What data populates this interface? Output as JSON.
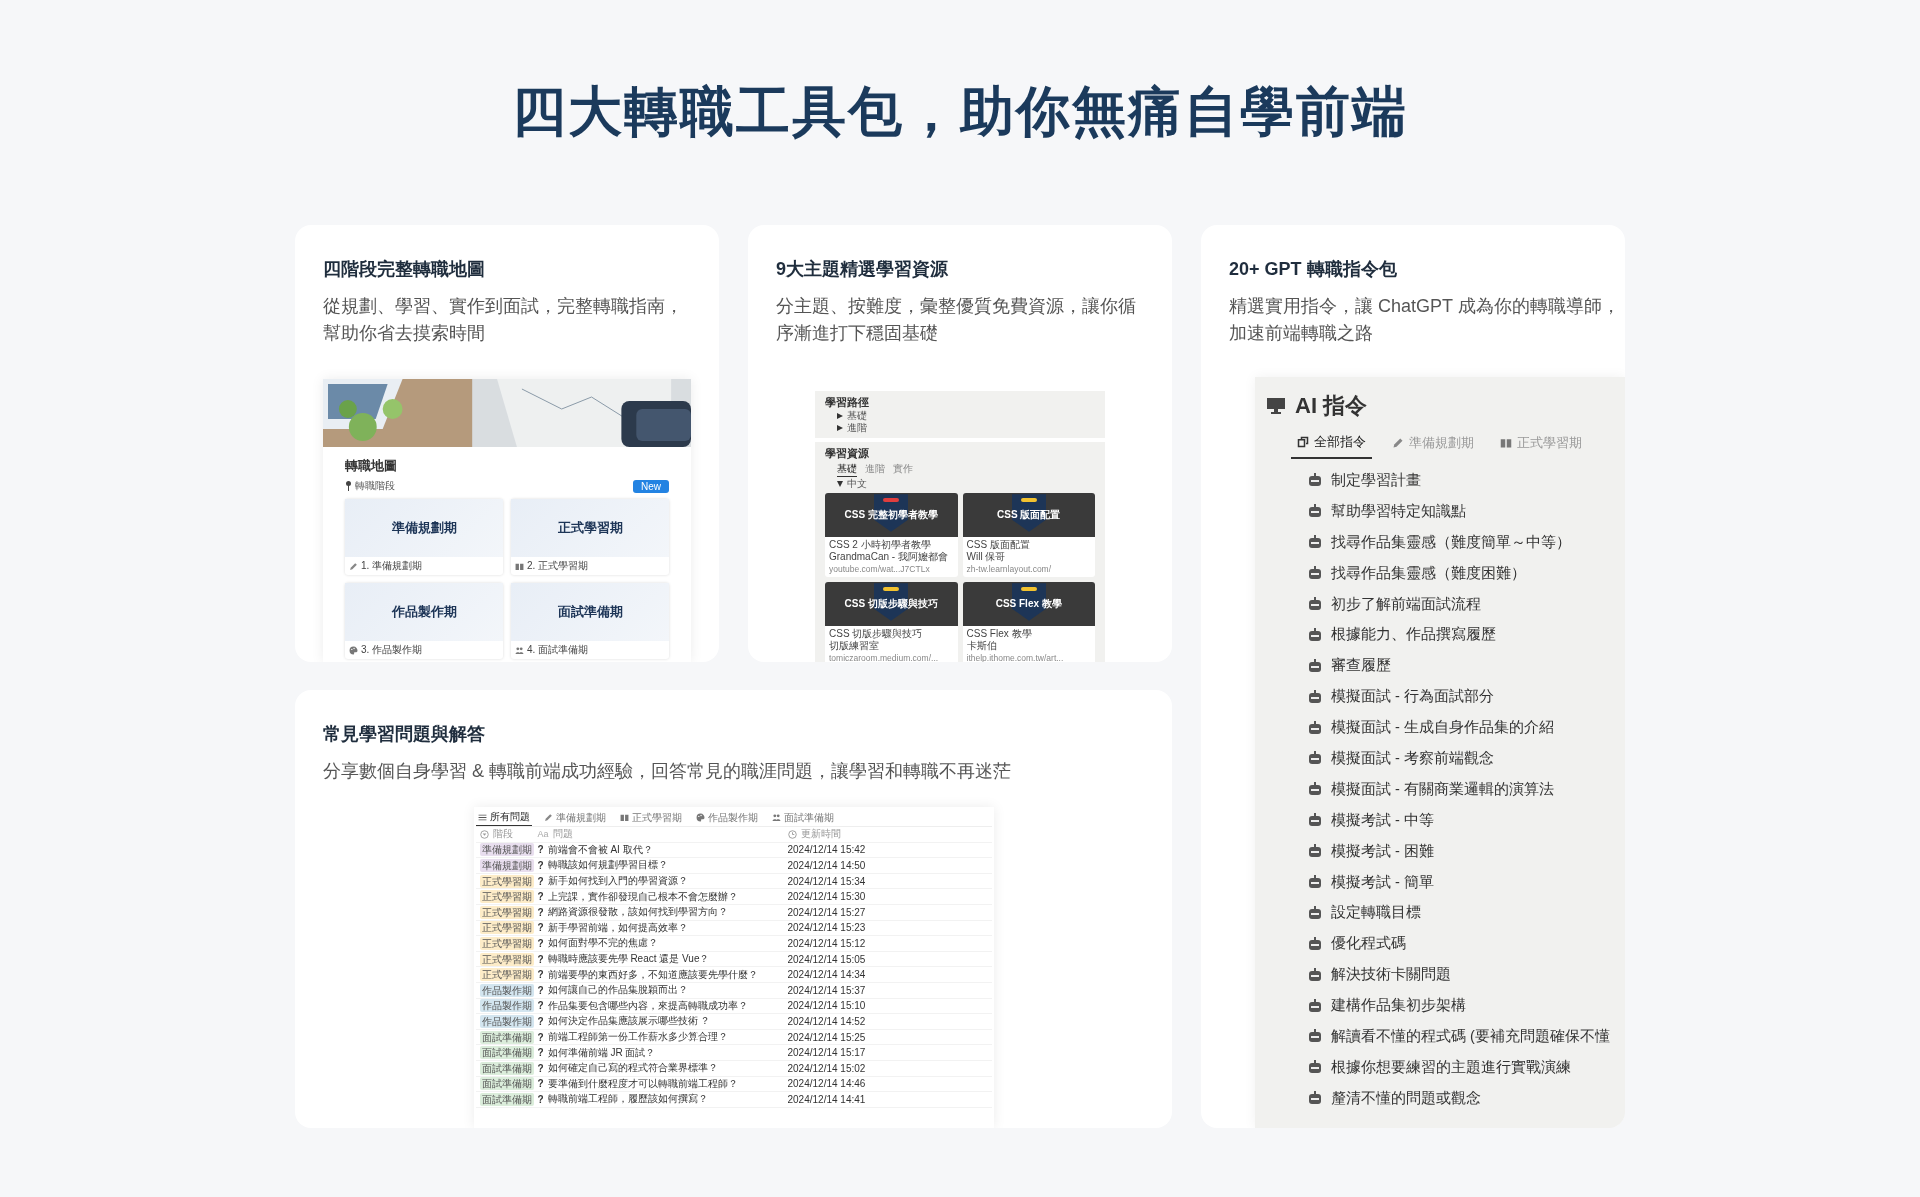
{
  "heading": "四大轉職工具包，助你無痛自學前端",
  "roadmap_card": {
    "title": "四階段完整轉職地圖",
    "description": "從規劃、學習、實作到面試，完整轉職指南，幫助你省去摸索時間",
    "preview": {
      "page_title": "轉職地圖",
      "view_label": "轉職階段",
      "new_button": "New",
      "gallery": [
        {
          "title": "準備規劃期",
          "caption": "1. 準備規劃期",
          "kind": "pencil"
        },
        {
          "title": "正式學習期",
          "caption": "2. 正式學習期",
          "kind": "book"
        },
        {
          "title": "作品製作期",
          "caption": "3. 作品製作期",
          "kind": "palette"
        },
        {
          "title": "面試準備期",
          "caption": "4. 面試準備期",
          "kind": "people"
        }
      ]
    }
  },
  "resources_card": {
    "title": "9大主題精選學習資源",
    "description": "分主題、按難度，彙整優質免費資源，讓你循序漸進打下穩固基礎",
    "preview": {
      "path_title": "學習路徑",
      "path_items": [
        "基礎",
        "進階"
      ],
      "resources_title": "學習資源",
      "tabs": [
        {
          "label": "基礎",
          "selected": true
        },
        {
          "label": "進階",
          "selected": false
        },
        {
          "label": "實作",
          "selected": false
        }
      ],
      "group": "中文",
      "items": [
        {
          "thumb_title": "CSS 完整初學者教學",
          "color": "#e03e3e",
          "title": "CSS 2 小時初學者教學",
          "author": "GrandmaCan - 我阿嬤都會",
          "link": "youtube.com/wat...J7CTLx"
        },
        {
          "thumb_title": "CSS 版面配置",
          "color": "#f2c230",
          "title": "CSS 版面配置",
          "author": "Will 保哥",
          "link": "zh-tw.learnlayout.com/"
        },
        {
          "thumb_title": "CSS 切版步驟與技巧",
          "color": "#f2c230",
          "title": "CSS 切版步驟與技巧",
          "author": "切版練習室",
          "link": "tomiczaroom.medium.com/..."
        },
        {
          "thumb_title": "CSS Flex 教學",
          "color": "#f2c230",
          "title": "CSS Flex 教學",
          "author": "卡斯伯",
          "link": "ithelp.ithome.com.tw/art..."
        }
      ]
    }
  },
  "gpt_card": {
    "title": "20+ GPT 轉職指令包",
    "description": "精選實用指令，讓 ChatGPT 成為你的轉職導師，加速前端轉職之路",
    "panel": {
      "title": "AI 指令",
      "tabs": [
        {
          "label": "全部指令",
          "selected": true,
          "kind": "window"
        },
        {
          "label": "準備規劃期",
          "selected": false,
          "kind": "pencil"
        },
        {
          "label": "正式學習期",
          "selected": false,
          "kind": "book"
        }
      ],
      "prompts": [
        "制定學習計畫",
        "幫助學習特定知識點",
        "找尋作品集靈感（難度簡單～中等）",
        "找尋作品集靈感（難度困難）",
        "初步了解前端面試流程",
        "根據能力、作品撰寫履歷",
        "審查履歷",
        "模擬面試 - 行為面試部分",
        "模擬面試 - 生成自身作品集的介紹",
        "模擬面試 - 考察前端觀念",
        "模擬面試 - 有關商業邏輯的演算法",
        "模擬考試 - 中等",
        "模擬考試 - 困難",
        "模擬考試 - 簡單",
        "設定轉職目標",
        "優化程式碼",
        "解決技術卡關問題",
        "建構作品集初步架構",
        "解讀看不懂的程式碼 (要補充問題確保不懂",
        "根據你想要練習的主題進行實戰演練",
        "釐清不懂的問題或觀念"
      ]
    }
  },
  "faq_card": {
    "title": "常見學習問題與解答",
    "description": "分享數個自身學習 & 轉職前端成功經驗，回答常見的職涯問題，讓學習和轉職不再迷茫",
    "table": {
      "tabs": [
        {
          "label": "所有問題",
          "selected": true,
          "kind": "list"
        },
        {
          "label": "準備規劃期",
          "selected": false,
          "kind": "pencil"
        },
        {
          "label": "正式學習期",
          "selected": false,
          "kind": "book"
        },
        {
          "label": "作品製作期",
          "selected": false,
          "kind": "palette"
        },
        {
          "label": "面試準備期",
          "selected": false,
          "kind": "people"
        }
      ],
      "columns": [
        {
          "kind": "select",
          "label": "階段"
        },
        {
          "kind": "title",
          "label": "問題",
          "type_mark": "Aa"
        },
        {
          "kind": "date",
          "label": "更新時間"
        }
      ],
      "rows": [
        {
          "stage": "準備規劃期",
          "color": "#e8deee",
          "icon": "?",
          "question": "前端會不會被 AI 取代？",
          "updated": "2024/12/14 15:42"
        },
        {
          "stage": "準備規劃期",
          "color": "#e8deee",
          "icon": "?",
          "question": "轉職該如何規劃學習目標？",
          "updated": "2024/12/14 14:50"
        },
        {
          "stage": "正式學習期",
          "color": "#fdecc8",
          "icon": "?",
          "question": "新手如何找到入門的學習資源？",
          "updated": "2024/12/14 15:34"
        },
        {
          "stage": "正式學習期",
          "color": "#fdecc8",
          "icon": "?",
          "question": "上完課，實作卻發現自己根本不會怎麼辦？",
          "updated": "2024/12/14 15:30"
        },
        {
          "stage": "正式學習期",
          "color": "#fdecc8",
          "icon": "?",
          "question": "網路資源很發散，該如何找到學習方向？",
          "updated": "2024/12/14 15:27"
        },
        {
          "stage": "正式學習期",
          "color": "#fdecc8",
          "icon": "?",
          "question": "新手學習前端，如何提高效率？",
          "updated": "2024/12/14 15:23"
        },
        {
          "stage": "正式學習期",
          "color": "#fdecc8",
          "icon": "?",
          "question": "如何面對學不完的焦慮？",
          "updated": "2024/12/14 15:12"
        },
        {
          "stage": "正式學習期",
          "color": "#fdecc8",
          "icon": "?",
          "question": "轉職時應該要先學 React 還是 Vue？",
          "updated": "2024/12/14 15:05"
        },
        {
          "stage": "正式學習期",
          "color": "#fdecc8",
          "icon": "?",
          "question": "前端要學的東西好多，不知道應該要先學什麼？",
          "updated": "2024/12/14 14:34"
        },
        {
          "stage": "作品製作期",
          "color": "#d3e5ef",
          "icon": "?",
          "question": "如何讓自己的作品集脫穎而出？",
          "updated": "2024/12/14 15:37"
        },
        {
          "stage": "作品製作期",
          "color": "#d3e5ef",
          "icon": "?",
          "question": "作品集要包含哪些內容，來提高轉職成功率？",
          "updated": "2024/12/14 15:10"
        },
        {
          "stage": "作品製作期",
          "color": "#d3e5ef",
          "icon": "?",
          "question": "如何決定作品集應該展示哪些技術 ？",
          "updated": "2024/12/14 14:52"
        },
        {
          "stage": "面試準備期",
          "color": "#dbeddb",
          "icon": "?",
          "question": "前端工程師第一份工作薪水多少算合理？",
          "updated": "2024/12/14 15:25"
        },
        {
          "stage": "面試準備期",
          "color": "#dbeddb",
          "icon": "?",
          "question": "如何準備前端 JR 面試？",
          "updated": "2024/12/14 15:17"
        },
        {
          "stage": "面試準備期",
          "color": "#dbeddb",
          "icon": "?",
          "question": "如何確定自己寫的程式符合業界標準？",
          "updated": "2024/12/14 15:02"
        },
        {
          "stage": "面試準備期",
          "color": "#dbeddb",
          "icon": "?",
          "question": "要準備到什麼程度才可以轉職前端工程師？",
          "updated": "2024/12/14 14:46"
        },
        {
          "stage": "面試準備期",
          "color": "#dbeddb",
          "icon": "?",
          "question": "轉職前端工程師，履歷該如何撰寫？",
          "updated": "2024/12/14 14:41"
        }
      ]
    }
  }
}
